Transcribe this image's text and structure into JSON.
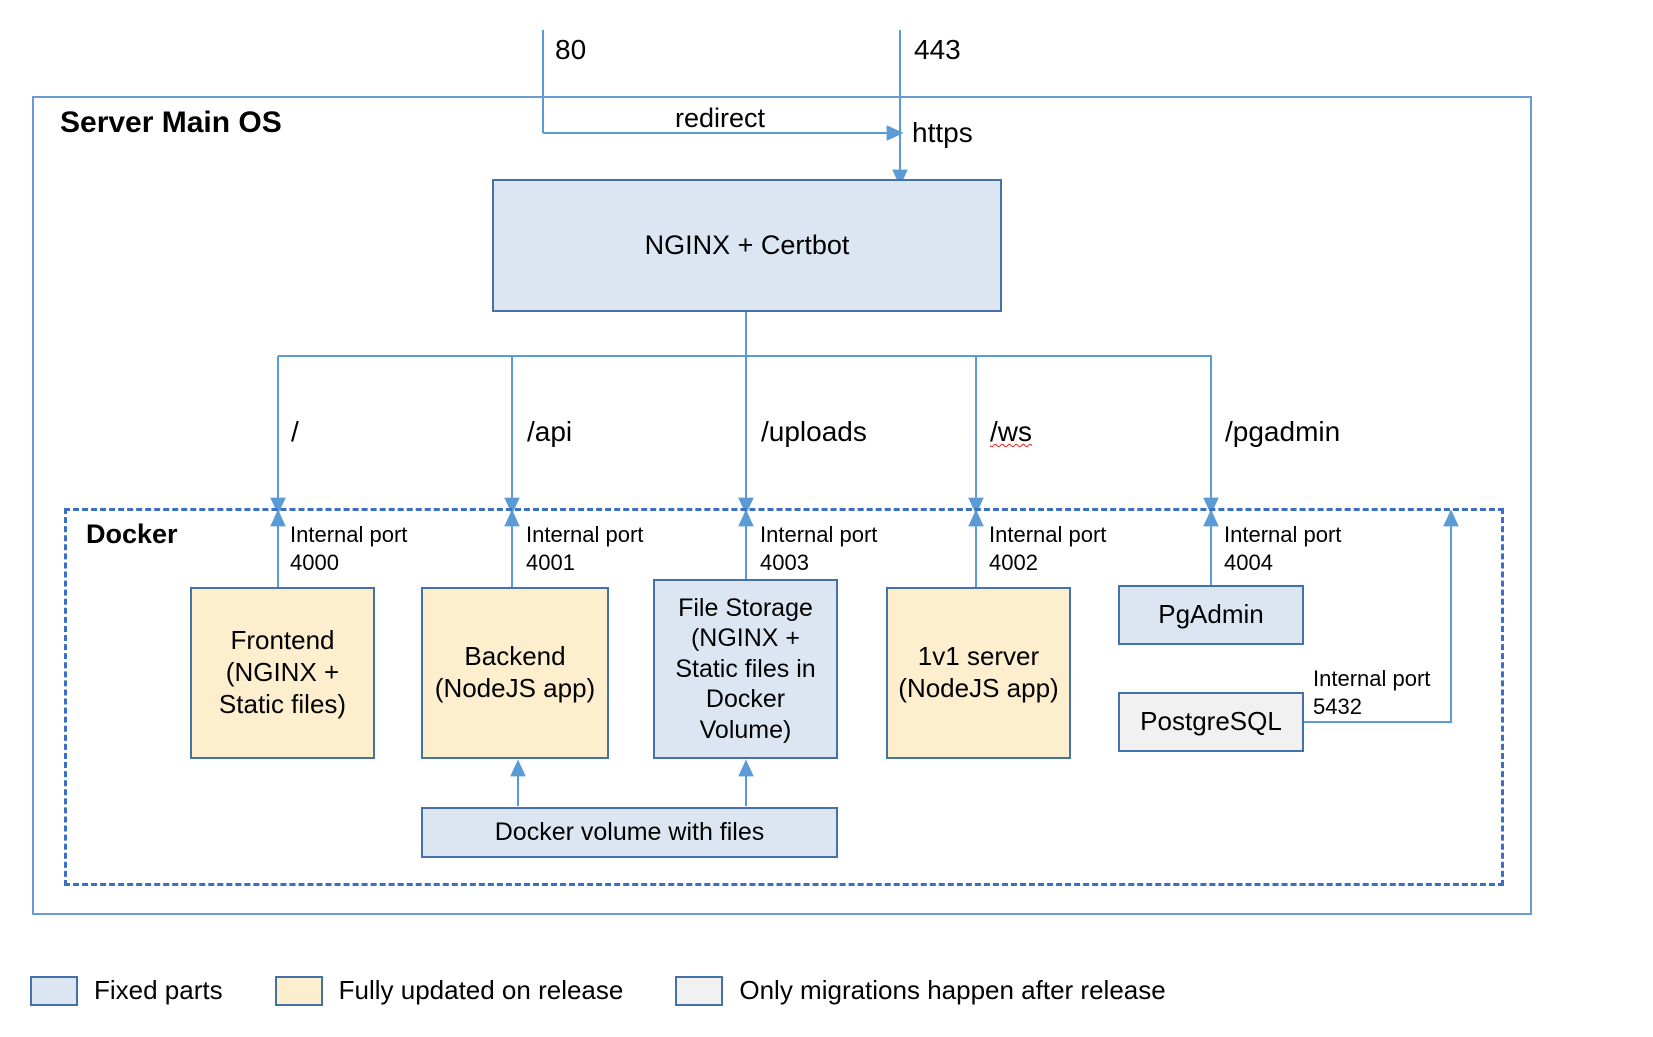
{
  "diagram": {
    "zones": {
      "server_os": "Server Main OS",
      "docker": "Docker"
    },
    "entry_ports": {
      "http": "80",
      "https_port": "443",
      "redirect_label": "redirect",
      "https_label": "https"
    },
    "gateway": {
      "label": "NGINX + Certbot"
    },
    "routes": [
      {
        "path": "/",
        "port_label": "Internal port",
        "port": "4000",
        "spellcheck_flag": false
      },
      {
        "path": "/api",
        "port_label": "Internal port",
        "port": "4001",
        "spellcheck_flag": false
      },
      {
        "path": "/uploads",
        "port_label": "Internal port",
        "port": "4003",
        "spellcheck_flag": false
      },
      {
        "path": "/ws",
        "port_label": "Internal port",
        "port": "4002",
        "spellcheck_flag": true
      },
      {
        "path": "/pgadmin",
        "port_label": "Internal port",
        "port": "4004",
        "spellcheck_flag": false
      }
    ],
    "services": [
      {
        "name": "Frontend\n(NGINX +\nStatic files)",
        "fill": "yellow"
      },
      {
        "name": "Backend\n(NodeJS app)",
        "fill": "yellow"
      },
      {
        "name": "File Storage\n(NGINX +\nStatic files in\nDocker\nVolume)",
        "fill": "blue"
      },
      {
        "name": "1v1 server\n(NodeJS app)",
        "fill": "yellow"
      },
      {
        "name": "PgAdmin",
        "fill": "blue"
      },
      {
        "name": "PostgreSQL",
        "fill": "gray"
      },
      {
        "name": "Docker volume with files",
        "fill": "blue"
      }
    ],
    "db_connection": {
      "port_label": "Internal port",
      "port": "5432"
    },
    "legend": [
      {
        "label": "Fixed parts",
        "fill": "blue",
        "color": "#dce6f2"
      },
      {
        "label": "Fully updated on release",
        "fill": "yellow",
        "color": "#fdeecd"
      },
      {
        "label": "Only migrations happen after release",
        "fill": "gray",
        "color": "#f1f1f1"
      }
    ],
    "colors": {
      "border_blue": "#4472a8",
      "wire_blue": "#5b9bd5",
      "docker_dash": "#3b6fc4",
      "os_border": "#6b9bd2"
    }
  }
}
